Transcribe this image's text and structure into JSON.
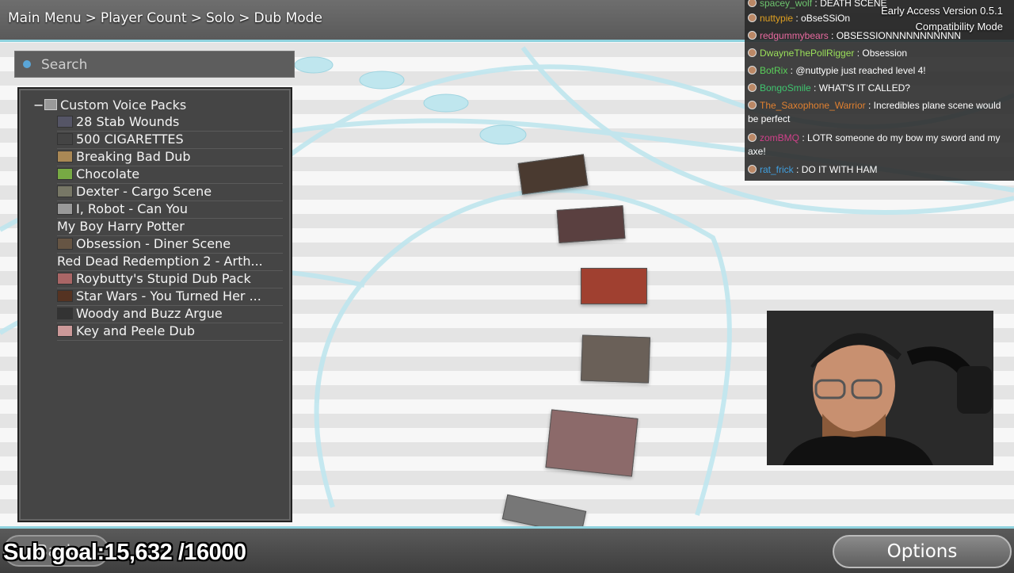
{
  "breadcrumb": [
    "Main Menu",
    "Player Count",
    "Solo",
    "Dub Mode"
  ],
  "search": {
    "placeholder": "Search"
  },
  "tree": {
    "root_label": "Custom Voice Packs",
    "items": [
      {
        "label": "28 Stab Wounds",
        "thumb": "#556"
      },
      {
        "label": "500 CIGARETTES",
        "thumb": "#444"
      },
      {
        "label": "Breaking Bad Dub",
        "thumb": "#a85"
      },
      {
        "label": "Chocolate",
        "thumb": "#7a4"
      },
      {
        "label": "Dexter - Cargo Scene",
        "thumb": "#776"
      },
      {
        "label": "I, Robot - Can You",
        "thumb": "#999"
      },
      {
        "label": "My Boy Harry Potter",
        "thumb": ""
      },
      {
        "label": "Obsession - Diner Scene",
        "thumb": "#654"
      },
      {
        "label": "Red Dead Redemption 2 - Arth...",
        "thumb": ""
      },
      {
        "label": "Roybutty's Stupid Dub Pack",
        "thumb": "#a66",
        "expandable": true
      },
      {
        "label": "Star Wars - You Turned Her ...",
        "thumb": "#532"
      },
      {
        "label": "Woody and Buzz Argue",
        "thumb": "#333"
      },
      {
        "label": "Key and Peele Dub",
        "thumb": "#c99"
      }
    ]
  },
  "chat": {
    "version": "Early Access Version 0.5.1",
    "mode": "Compatibility Mode",
    "messages": [
      {
        "user": "spacey_wolf",
        "text": "DEATH SCENE",
        "color": "#6ec46e"
      },
      {
        "user": "nuttypie",
        "text": "oBseSSiOn",
        "color": "#e0a020"
      },
      {
        "user": "redgummybears",
        "text": "OBSESSIONNNNNNNNNNN",
        "color": "#e86aa0"
      },
      {
        "user": "DwayneThePollRigger",
        "text": "Obsession",
        "color": "#9be05a"
      },
      {
        "user": "BotRix",
        "text": "@nuttypie just reached level 4!",
        "color": "#5ad05a"
      },
      {
        "user": "BongoSmile",
        "text": "WHAT'S IT CALLED?",
        "color": "#3ec46e"
      },
      {
        "user": "The_Saxophone_Warrior",
        "text": "Incredibles plane scene would be perfect",
        "color": "#e08030"
      },
      {
        "user": "zomBMQ",
        "text": "LOTR someone do my bow my sword and my axe!",
        "color": "#d0408a"
      },
      {
        "user": "rat_frick",
        "text": "DO IT WITH HAM",
        "color": "#40a0e0"
      }
    ]
  },
  "bottom": {
    "back_label": "Back",
    "options_label": "Options",
    "subgoal": "Sub goal:15,632 /16000"
  }
}
